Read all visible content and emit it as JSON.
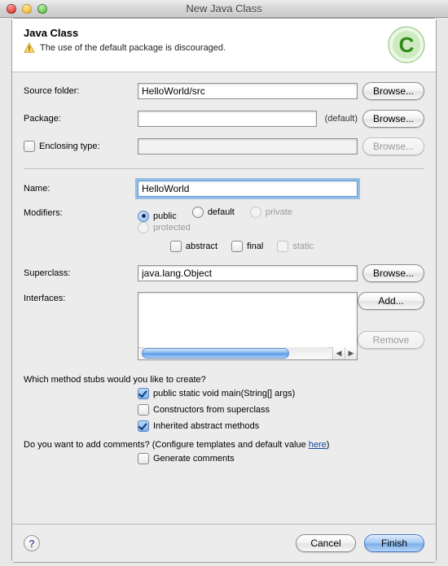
{
  "window": {
    "title": "New Java Class"
  },
  "header": {
    "heading": "Java Class",
    "warning": "The use of the default package is discouraged."
  },
  "fields": {
    "source_folder": {
      "label": "Source folder:",
      "value": "HelloWorld/src",
      "browse": "Browse..."
    },
    "package": {
      "label": "Package:",
      "value": "",
      "hint": "(default)",
      "browse": "Browse..."
    },
    "enclosing": {
      "label": "Enclosing type:",
      "value": "",
      "browse": "Browse..."
    },
    "name": {
      "label": "Name:",
      "value": "HelloWorld"
    },
    "modifiers": {
      "label": "Modifiers:",
      "public": "public",
      "default": "default",
      "private": "private",
      "protected": "protected",
      "abstract": "abstract",
      "final": "final",
      "static": "static"
    },
    "superclass": {
      "label": "Superclass:",
      "value": "java.lang.Object",
      "browse": "Browse..."
    },
    "interfaces": {
      "label": "Interfaces:",
      "add": "Add...",
      "remove": "Remove"
    }
  },
  "stubs": {
    "question": "Which method stubs would you like to create?",
    "main": "public static void main(String[] args)",
    "ctors": "Constructors from superclass",
    "inherited": "Inherited abstract methods"
  },
  "comments": {
    "question_prefix": "Do you want to add comments? (Configure templates and default value ",
    "link": "here",
    "question_suffix": ")",
    "generate": "Generate comments"
  },
  "footer": {
    "cancel": "Cancel",
    "finish": "Finish"
  }
}
